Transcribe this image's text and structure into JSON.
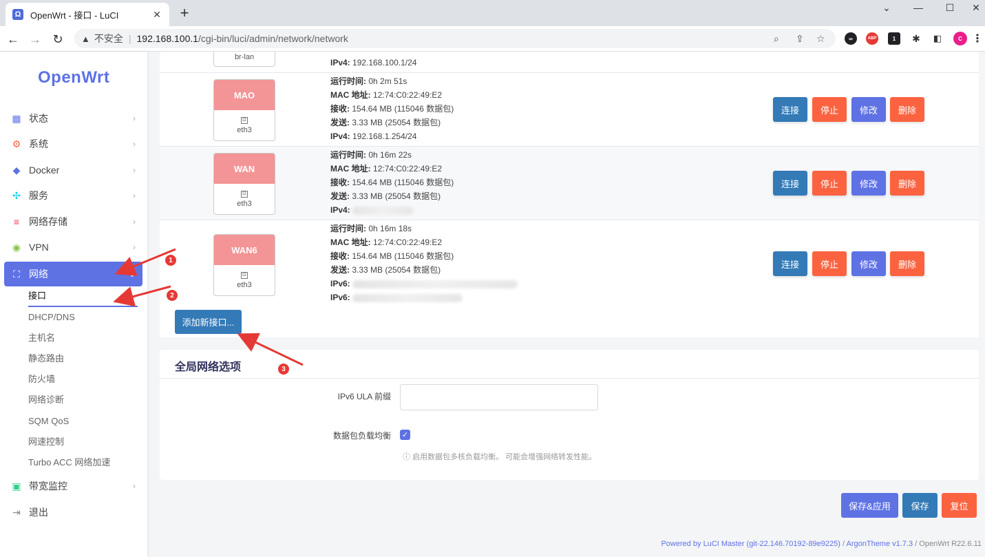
{
  "browser": {
    "tab_title": "OpenWrt - 接口 - LuCI",
    "tab_favicon": "Ω",
    "insecure_label": "不安全",
    "url_host": "192.168.100.1",
    "url_path": "/cgi-bin/luci/admin/network/network",
    "extensions": [
      {
        "name": "infinity-extension-icon",
        "label": "∞",
        "color": "#202124"
      },
      {
        "name": "abp-extension-icon",
        "label": "ABP",
        "color": "#e53935"
      },
      {
        "name": "notification-extension-icon",
        "label": "1",
        "color": "#202124"
      },
      {
        "name": "profile-avatar",
        "label": "C",
        "color": "#e91e8c"
      }
    ]
  },
  "sidebar": {
    "logo": "OpenWrt",
    "menu": [
      {
        "label": "状态",
        "icon": "dashboard-icon"
      },
      {
        "label": "系统",
        "icon": "gear-icon"
      },
      {
        "label": "Docker",
        "icon": "docker-icon"
      },
      {
        "label": "服务",
        "icon": "services-icon"
      },
      {
        "label": "网络存储",
        "icon": "storage-icon"
      },
      {
        "label": "VPN",
        "icon": "vpn-icon"
      },
      {
        "label": "网络",
        "icon": "network-icon"
      }
    ],
    "submenu": [
      "接口",
      "DHCP/DNS",
      "主机名",
      "静态路由",
      "防火墙",
      "网络诊断",
      "SQM QoS",
      "网速控制",
      "Turbo ACC 网络加速"
    ],
    "menu_bottom": [
      {
        "label": "带宽监控",
        "icon": "bandwidth-icon"
      },
      {
        "label": "退出",
        "icon": "logout-icon"
      }
    ]
  },
  "top_partial": {
    "badge_label": "br-lan",
    "ipv4_label": "IPv4:",
    "ipv4_value": "192.168.100.1/24"
  },
  "interfaces": [
    {
      "name": "MAO",
      "device": "eth3",
      "uptime_label": "运行时间:",
      "uptime": "0h 2m 51s",
      "mac_label": "MAC 地址:",
      "mac": "12:74:C0:22:49:E2",
      "rx_label": "接收:",
      "rx": "154.64 MB (115046 数据包)",
      "tx_label": "发送:",
      "tx": "3.33 MB (25054 数据包)",
      "addr1_label": "IPv4:",
      "addr1": "192.168.1.254/24"
    },
    {
      "name": "WAN",
      "device": "eth3",
      "uptime_label": "运行时间:",
      "uptime": "0h 16m 22s",
      "mac_label": "MAC 地址:",
      "mac": "12:74:C0:22:49:E2",
      "rx_label": "接收:",
      "rx": "154.64 MB (115046 数据包)",
      "tx_label": "发送:",
      "tx": "3.33 MB (25054 数据包)",
      "addr1_label": "IPv4:"
    },
    {
      "name": "WAN6",
      "device": "eth3",
      "uptime_label": "运行时间:",
      "uptime": "0h 16m 18s",
      "mac_label": "MAC 地址:",
      "mac": "12:74:C0:22:49:E2",
      "rx_label": "接收:",
      "rx": "154.64 MB (115046 数据包)",
      "tx_label": "发送:",
      "tx": "3.33 MB (25054 数据包)",
      "addr1_label": "IPv6:",
      "addr2_label": "IPv6:"
    }
  ],
  "actions": {
    "connect": "连接",
    "stop": "停止",
    "edit": "修改",
    "delete": "删除"
  },
  "add_interface_label": "添加新接口...",
  "global_options": {
    "title": "全局网络选项",
    "ula_label": "IPv6 ULA 前缀",
    "ula_value": "",
    "balance_label": "数据包负载均衡",
    "balance_checked": true,
    "balance_hint": "启用数据包多核负载均衡。 可能会增强网络转发性能。"
  },
  "bottom_actions": {
    "save_apply": "保存&应用",
    "save": "保存",
    "reset": "复位"
  },
  "footer": {
    "powered": "Powered by LuCI Master (git-22.146.70192-89e9225)",
    "sep": " / ",
    "theme": "ArgonTheme v1.7.3",
    "version": " / OpenWrt R22.6.11"
  },
  "annotations": [
    "1",
    "2",
    "3"
  ],
  "colors": {
    "accent": "#5e72e4",
    "connect": "#337ab7",
    "danger": "#fb6340",
    "badge": "#f39496",
    "annotation": "#e53935"
  }
}
